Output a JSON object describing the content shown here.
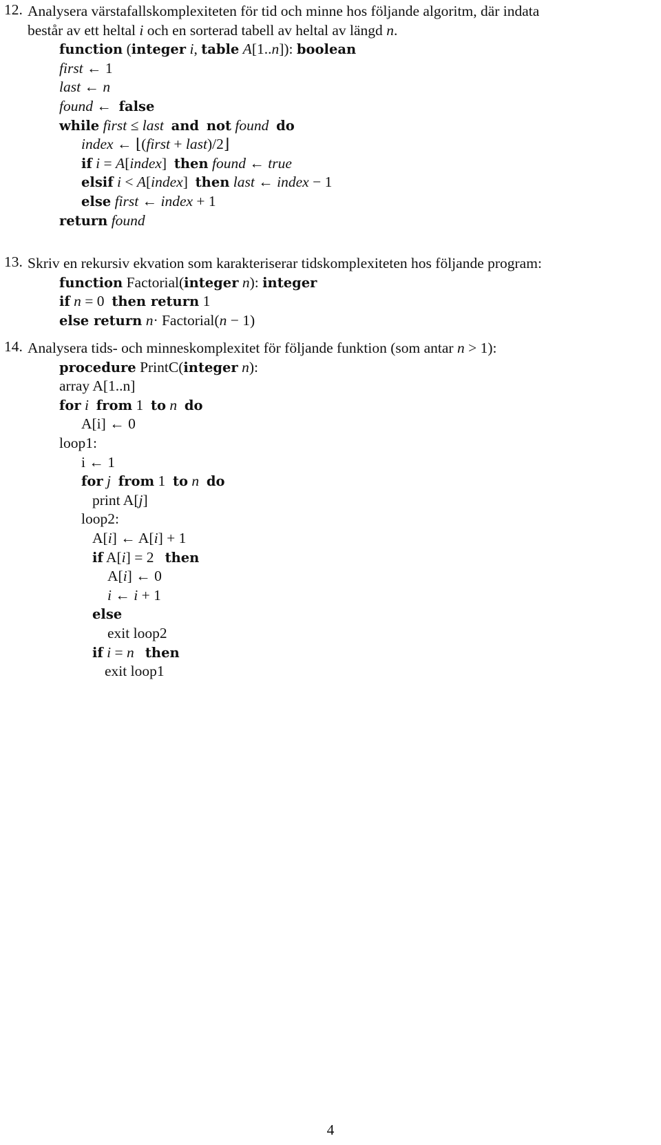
{
  "problems": [
    {
      "number": "12.",
      "prompt": [
        [
          {
            "t": "Analysera värstafallskomplexiteten för tid och minne hos följande algoritm, där indata"
          }
        ],
        [
          {
            "t": "består av ett heltal "
          },
          {
            "t": "i",
            "s": "i"
          },
          {
            "t": " och en sorterad tabell av heltal av längd "
          },
          {
            "t": "n",
            "s": "i"
          },
          {
            "t": "."
          }
        ]
      ],
      "code": [
        {
          "indent": 0,
          "seg": [
            {
              "t": "function",
              "s": "b"
            },
            {
              "t": " ("
            },
            {
              "t": "integer",
              "s": "b"
            },
            {
              "t": " "
            },
            {
              "t": "i",
              "s": "i"
            },
            {
              "t": ", "
            },
            {
              "t": "table",
              "s": "b"
            },
            {
              "t": " "
            },
            {
              "t": "A",
              "s": "i"
            },
            {
              "t": "[1.."
            },
            {
              "t": "n",
              "s": "i"
            },
            {
              "t": "]): "
            },
            {
              "t": "boolean",
              "s": "b"
            }
          ]
        },
        {
          "indent": 0,
          "seg": [
            {
              "t": "first",
              "s": "i"
            },
            {
              "t": " ← 1"
            }
          ]
        },
        {
          "indent": 0,
          "seg": [
            {
              "t": "last",
              "s": "i"
            },
            {
              "t": " ← "
            },
            {
              "t": "n",
              "s": "i"
            }
          ]
        },
        {
          "indent": 0,
          "seg": [
            {
              "t": "found",
              "s": "i"
            },
            {
              "t": " ←  "
            },
            {
              "t": "false",
              "s": "b"
            }
          ]
        },
        {
          "indent": 0,
          "seg": [
            {
              "t": "while",
              "s": "b"
            },
            {
              "t": " "
            },
            {
              "t": "first",
              "s": "i"
            },
            {
              "t": " ≤ "
            },
            {
              "t": "last",
              "s": "i"
            },
            {
              "t": "  "
            },
            {
              "t": "and",
              "s": "b"
            },
            {
              "t": "  "
            },
            {
              "t": "not",
              "s": "b"
            },
            {
              "t": " "
            },
            {
              "t": "found",
              "s": "i"
            },
            {
              "t": "  "
            },
            {
              "t": "do",
              "s": "b"
            }
          ]
        },
        {
          "indent": 1,
          "seg": [
            {
              "t": "index",
              "s": "i"
            },
            {
              "t": " ← ⌊("
            },
            {
              "t": "first",
              "s": "i"
            },
            {
              "t": " + "
            },
            {
              "t": "last",
              "s": "i"
            },
            {
              "t": ")/2⌋"
            }
          ]
        },
        {
          "indent": 1,
          "seg": [
            {
              "t": "if",
              "s": "b"
            },
            {
              "t": " "
            },
            {
              "t": "i",
              "s": "i"
            },
            {
              "t": " = "
            },
            {
              "t": "A",
              "s": "i"
            },
            {
              "t": "["
            },
            {
              "t": "index",
              "s": "i"
            },
            {
              "t": "]  "
            },
            {
              "t": "then",
              "s": "b"
            },
            {
              "t": " "
            },
            {
              "t": "found",
              "s": "i"
            },
            {
              "t": " ← "
            },
            {
              "t": "true",
              "s": "i"
            }
          ]
        },
        {
          "indent": 1,
          "seg": [
            {
              "t": "elsif",
              "s": "b"
            },
            {
              "t": " "
            },
            {
              "t": "i",
              "s": "i"
            },
            {
              "t": " < "
            },
            {
              "t": "A",
              "s": "i"
            },
            {
              "t": "["
            },
            {
              "t": "index",
              "s": "i"
            },
            {
              "t": "]  "
            },
            {
              "t": "then",
              "s": "b"
            },
            {
              "t": " "
            },
            {
              "t": "last",
              "s": "i"
            },
            {
              "t": " ← "
            },
            {
              "t": "index",
              "s": "i"
            },
            {
              "t": " − 1"
            }
          ]
        },
        {
          "indent": 1,
          "seg": [
            {
              "t": "else",
              "s": "b"
            },
            {
              "t": " "
            },
            {
              "t": "first",
              "s": "i"
            },
            {
              "t": " ← "
            },
            {
              "t": "index",
              "s": "i"
            },
            {
              "t": " + 1"
            }
          ]
        },
        {
          "indent": 0,
          "seg": [
            {
              "t": "return",
              "s": "b"
            },
            {
              "t": " "
            },
            {
              "t": "found",
              "s": "i"
            }
          ]
        }
      ]
    },
    {
      "number": "13.",
      "prompt": [
        [
          {
            "t": "Skriv en rekursiv ekvation som karakteriserar tidskomplexiteten hos följande program:"
          }
        ]
      ],
      "code": [
        {
          "indent": 0,
          "seg": [
            {
              "t": "function",
              "s": "b"
            },
            {
              "t": " Factorial("
            },
            {
              "t": "integer",
              "s": "b"
            },
            {
              "t": " "
            },
            {
              "t": "n",
              "s": "i"
            },
            {
              "t": "): "
            },
            {
              "t": "integer",
              "s": "b"
            }
          ]
        },
        {
          "indent": 0,
          "seg": [
            {
              "t": "if",
              "s": "b"
            },
            {
              "t": " "
            },
            {
              "t": "n",
              "s": "i"
            },
            {
              "t": " = 0  "
            },
            {
              "t": "then return",
              "s": "b"
            },
            {
              "t": " 1"
            }
          ]
        },
        {
          "indent": 0,
          "seg": [
            {
              "t": "else return",
              "s": "b"
            },
            {
              "t": " "
            },
            {
              "t": "n",
              "s": "i"
            },
            {
              "t": "· Factorial("
            },
            {
              "t": "n",
              "s": "i"
            },
            {
              "t": " − 1)"
            }
          ]
        }
      ]
    },
    {
      "number": "14.",
      "prompt": [
        [
          {
            "t": "Analysera tids- och minneskomplexitet för följande funktion (som antar "
          },
          {
            "t": "n",
            "s": "i"
          },
          {
            "t": " > 1):"
          }
        ]
      ],
      "code": [
        {
          "indent": 0,
          "seg": [
            {
              "t": "procedure",
              "s": "b"
            },
            {
              "t": " PrintC("
            },
            {
              "t": "integer",
              "s": "b"
            },
            {
              "t": " "
            },
            {
              "t": "n",
              "s": "i"
            },
            {
              "t": "):"
            }
          ]
        },
        {
          "indent": 0,
          "seg": [
            {
              "t": "array A[1..n]"
            }
          ]
        },
        {
          "indent": 0,
          "seg": [
            {
              "t": "for",
              "s": "b"
            },
            {
              "t": " "
            },
            {
              "t": "i",
              "s": "i"
            },
            {
              "t": "  "
            },
            {
              "t": "from",
              "s": "b"
            },
            {
              "t": " 1  "
            },
            {
              "t": "to",
              "s": "b"
            },
            {
              "t": " "
            },
            {
              "t": "n",
              "s": "i"
            },
            {
              "t": "  "
            },
            {
              "t": "do",
              "s": "b"
            }
          ]
        },
        {
          "indent": 1,
          "seg": [
            {
              "t": "A[i] ← 0"
            }
          ]
        },
        {
          "indent": 0,
          "seg": [
            {
              "t": "loop1:"
            }
          ]
        },
        {
          "indent": 1,
          "seg": [
            {
              "t": "i ← 1"
            }
          ]
        },
        {
          "indent": 1,
          "seg": [
            {
              "t": "for",
              "s": "b"
            },
            {
              "t": " "
            },
            {
              "t": "j",
              "s": "i"
            },
            {
              "t": "  "
            },
            {
              "t": "from",
              "s": "b"
            },
            {
              "t": " 1  "
            },
            {
              "t": "to",
              "s": "b"
            },
            {
              "t": " "
            },
            {
              "t": "n",
              "s": "i"
            },
            {
              "t": "  "
            },
            {
              "t": "do",
              "s": "b"
            }
          ]
        },
        {
          "indent": 2,
          "seg": [
            {
              "t": "print A["
            },
            {
              "t": "j",
              "s": "i"
            },
            {
              "t": "]"
            }
          ]
        },
        {
          "indent": 1,
          "seg": [
            {
              "t": "loop2:"
            }
          ]
        },
        {
          "indent": 2,
          "seg": [
            {
              "t": "A["
            },
            {
              "t": "i",
              "s": "i"
            },
            {
              "t": "] ← A["
            },
            {
              "t": "i",
              "s": "i"
            },
            {
              "t": "] + 1"
            }
          ]
        },
        {
          "indent": 2,
          "seg": [
            {
              "t": "if",
              "s": "b"
            },
            {
              "t": " A["
            },
            {
              "t": "i",
              "s": "i"
            },
            {
              "t": "] = 2   "
            },
            {
              "t": "then",
              "s": "b"
            }
          ]
        },
        {
          "indent": 3,
          "seg": [
            {
              "t": "A["
            },
            {
              "t": "i",
              "s": "i"
            },
            {
              "t": "] ← 0"
            }
          ]
        },
        {
          "indent": 3,
          "seg": [
            {
              "t": "i",
              "s": "i"
            },
            {
              "t": " ← "
            },
            {
              "t": "i",
              "s": "i"
            },
            {
              "t": " + 1"
            }
          ]
        },
        {
          "indent": 2,
          "seg": [
            {
              "t": "else",
              "s": "b"
            }
          ]
        },
        {
          "indent": 3,
          "seg": [
            {
              "t": "exit loop2"
            }
          ]
        },
        {
          "indent": 2,
          "seg": [
            {
              "t": "if",
              "s": "b"
            },
            {
              "t": " "
            },
            {
              "t": "i",
              "s": "i"
            },
            {
              "t": " = "
            },
            {
              "t": "n",
              "s": "i"
            },
            {
              "t": "   "
            },
            {
              "t": "then",
              "s": "b"
            }
          ]
        },
        {
          "indent": 4,
          "seg": [
            {
              "t": "exit loop1"
            }
          ]
        }
      ]
    }
  ],
  "page_number": "4"
}
